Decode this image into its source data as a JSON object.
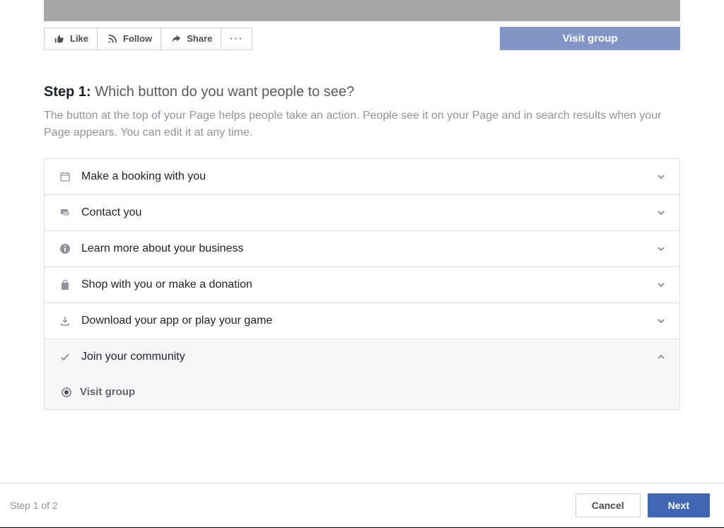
{
  "actionbar": {
    "like": "Like",
    "follow": "Follow",
    "share": "Share",
    "more": "···",
    "visit": "Visit group"
  },
  "header": {
    "step_label": "Step 1:",
    "question": "Which button do you want people to see?",
    "description": "The button at the top of your Page helps people take an action. People see it on your Page and in search results when your Page appears. You can edit it at any time."
  },
  "options": [
    {
      "label": "Make a booking with you",
      "expanded": false
    },
    {
      "label": "Contact you",
      "expanded": false
    },
    {
      "label": "Learn more about your business",
      "expanded": false
    },
    {
      "label": "Shop with you or make a donation",
      "expanded": false
    },
    {
      "label": "Download your app or play your game",
      "expanded": false
    },
    {
      "label": "Join your community",
      "expanded": true
    }
  ],
  "subOption": {
    "label": "Visit group",
    "selected": true
  },
  "footer": {
    "step": "Step 1 of 2",
    "cancel": "Cancel",
    "next": "Next"
  }
}
